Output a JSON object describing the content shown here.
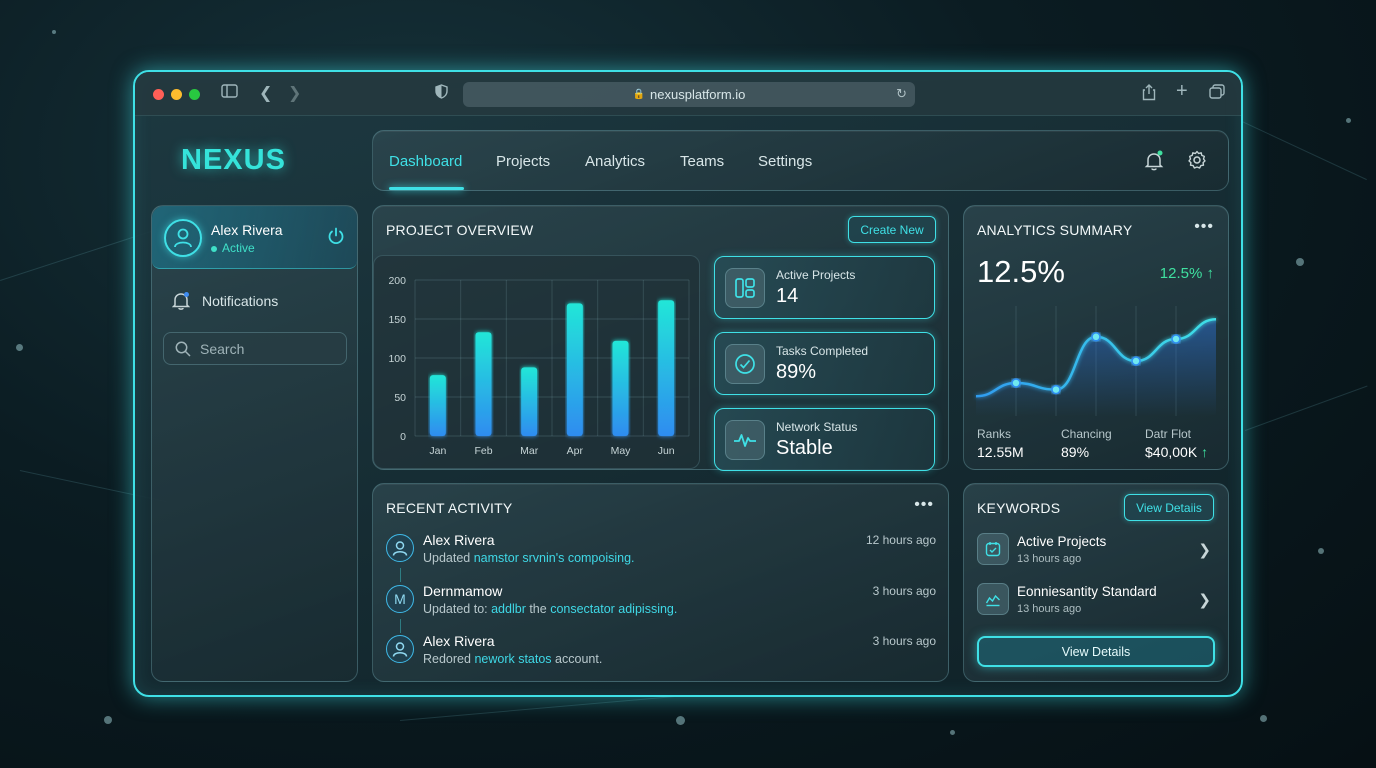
{
  "browser": {
    "url": "nexusplatform.io"
  },
  "brand": {
    "logo": "NEXUS"
  },
  "sidebar": {
    "user": {
      "name": "Alex Rivera",
      "status": "Active"
    },
    "items": [
      {
        "label": "Notifications",
        "icon": "bell-icon"
      }
    ],
    "search": {
      "placeholder": "Search"
    }
  },
  "nav": {
    "tabs": [
      {
        "label": "Dashboard",
        "active": true
      },
      {
        "label": "Projects"
      },
      {
        "label": "Analytics"
      },
      {
        "label": "Teams"
      },
      {
        "label": "Settings"
      }
    ]
  },
  "overview": {
    "title": "PROJECT OVERVIEW",
    "create_label": "Create New",
    "stats": [
      {
        "label": "Active Projects",
        "value": "14",
        "icon": "dashboard-grid-icon"
      },
      {
        "label": "Tasks Completed",
        "value": "89%",
        "icon": "check-circle-icon"
      },
      {
        "label": "Network Status",
        "value": "Stable",
        "icon": "pulse-icon"
      }
    ]
  },
  "chart_data": {
    "type": "bar",
    "categories": [
      "Jan",
      "Feb",
      "Mar",
      "Apr",
      "May",
      "Jun"
    ],
    "values": [
      78,
      133,
      88,
      170,
      122,
      174
    ],
    "ylim": [
      0,
      200
    ],
    "yticks": [
      0,
      50,
      100,
      150,
      200
    ],
    "grid": true,
    "bar_color_top": "#22e6d8",
    "bar_color_bottom": "#2f8cf0"
  },
  "analytics": {
    "title": "ANALYTICS SUMMARY",
    "big_value": "12.5%",
    "trend": "12.5% ↑",
    "trend_color": "#3fe0a0",
    "line": [
      18,
      30,
      24,
      72,
      50,
      70,
      88
    ],
    "metrics": [
      {
        "label": "Ranks",
        "value": "12.55M"
      },
      {
        "label": "Chancing",
        "value": "89%"
      },
      {
        "label": "Datr Flot",
        "value": "$40,00K",
        "arrow": "↑"
      }
    ]
  },
  "activity": {
    "title": "RECENT ACTIVITY",
    "items": [
      {
        "initial": "",
        "name": "Alex Rivera",
        "prefix": "Updated ",
        "highlight": "namstor srvnin's compoising.",
        "suffix": "",
        "time": "12 hours ago"
      },
      {
        "initial": "M",
        "name": "Dernmamow",
        "prefix": "Updated to: ",
        "highlight": "addlbr",
        "middle": " the ",
        "highlight2": "consectator adipissing.",
        "time": "3 hours ago"
      },
      {
        "initial": "",
        "name": "Alex Rivera",
        "prefix": "Redored ",
        "highlight": "nework statos",
        "suffix": " account.",
        "time": "3 hours ago"
      }
    ]
  },
  "keywords": {
    "title": "KEYWORDS",
    "header_button": "View Detaiis",
    "items": [
      {
        "name": "Active Projects",
        "time": "13 hours ago",
        "icon": "calendar-icon"
      },
      {
        "name": "Eonniesantity Standard",
        "time": "13 hours ago",
        "icon": "chart-icon"
      }
    ],
    "footer_button": "View Details"
  },
  "colors": {
    "accent": "#3fe0e6",
    "brand": "#35e3da"
  }
}
